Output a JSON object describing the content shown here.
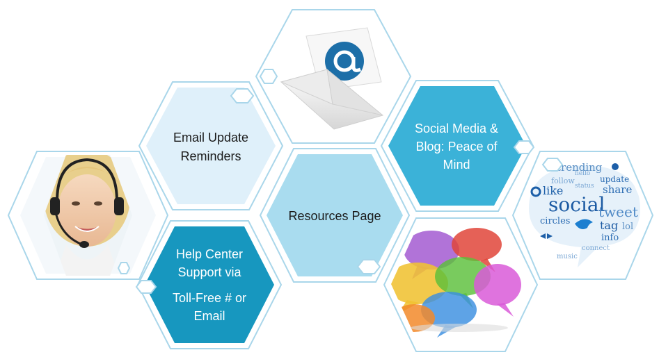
{
  "colors": {
    "outline": "#a9d6ea",
    "pale_fill": "#dff0fa",
    "light_fill": "#a9dcef",
    "mid_fill": "#3bb2d8",
    "dark_fill": "#1797bf",
    "text_dark": "#1a1a1a",
    "text_light": "#ffffff"
  },
  "hexagons": [
    {
      "id": "email-update",
      "lines": [
        "Email Update",
        "Reminders"
      ]
    },
    {
      "id": "resources",
      "lines": [
        "Resources Page"
      ]
    },
    {
      "id": "social-media",
      "lines": [
        "Social Media &",
        "Blog: Peace of",
        "Mind"
      ]
    },
    {
      "id": "help-center",
      "lines": [
        "Help Center",
        "Support via",
        "Toll-Free # or",
        "Email"
      ]
    },
    {
      "id": "email-icon",
      "icon": "email-envelope-at-icon"
    },
    {
      "id": "support-agent",
      "icon": "headset-agent-photo"
    },
    {
      "id": "speech-bubbles",
      "icon": "speech-bubbles-icon"
    },
    {
      "id": "social-word-cloud",
      "icon": "social-word-cloud-icon"
    }
  ],
  "word_cloud": {
    "words": [
      "trending",
      "follow",
      "update",
      "share",
      "like",
      "social",
      "tweet",
      "circles",
      "tag",
      "lol",
      "info",
      "connect",
      "music",
      "hello",
      "status"
    ]
  }
}
